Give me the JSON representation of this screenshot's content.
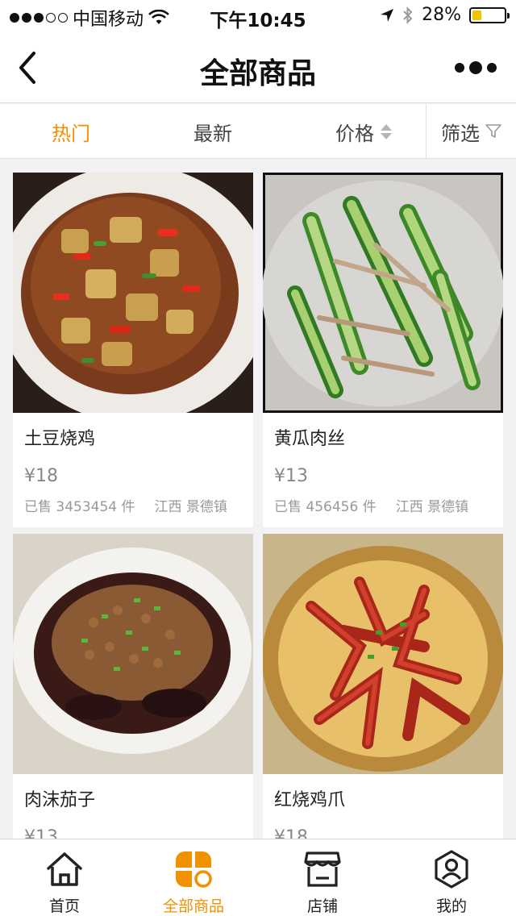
{
  "status_bar": {
    "carrier": "中国移动",
    "time": "下午10:45",
    "battery": "28%",
    "battery_level": 0.28,
    "signal_bars": 3
  },
  "nav": {
    "title": "全部商品",
    "back_icon": "back-chevron-icon",
    "more_icon": "more-dots-icon"
  },
  "filters": {
    "hot": "热门",
    "newest": "最新",
    "price": "价格",
    "screen": "筛选",
    "active_color": "#f19000"
  },
  "products": [
    {
      "name": "土豆烧鸡",
      "price": "¥18",
      "sold": "已售 3453454 件",
      "location": "江西 景德镇"
    },
    {
      "name": "黄瓜肉丝",
      "price": "¥13",
      "sold": "已售 456456 件",
      "location": "江西 景德镇"
    },
    {
      "name": "肉沫茄子",
      "price": "¥13",
      "sold": "",
      "location": ""
    },
    {
      "name": "红烧鸡爪",
      "price": "¥18",
      "sold": "",
      "location": ""
    }
  ],
  "tabbar": {
    "items": [
      {
        "label": "首页",
        "icon": "home-icon"
      },
      {
        "label": "全部商品",
        "icon": "all-products-icon"
      },
      {
        "label": "店铺",
        "icon": "store-icon"
      },
      {
        "label": "我的",
        "icon": "profile-icon"
      }
    ],
    "active_index": 1,
    "active_color": "#f19000"
  }
}
